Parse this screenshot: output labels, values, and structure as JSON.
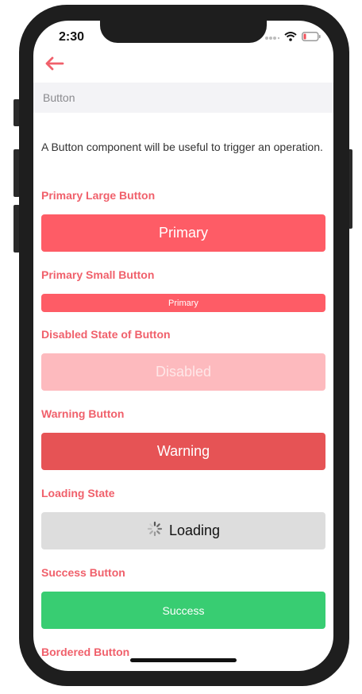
{
  "status_bar": {
    "time": "2:30"
  },
  "header": {
    "back_icon": "arrow-left-icon",
    "section_title": "Button"
  },
  "intro": {
    "text": "A Button component will be useful to trigger an operation."
  },
  "sections": {
    "primary_large": {
      "label": "Primary Large Button",
      "button_text": "Primary"
    },
    "primary_small": {
      "label": "Primary Small Button",
      "button_text": "Primary"
    },
    "disabled": {
      "label": "Disabled State of Button",
      "button_text": "Disabled"
    },
    "warning": {
      "label": "Warning Button",
      "button_text": "Warning"
    },
    "loading": {
      "label": "Loading State",
      "button_text": "Loading"
    },
    "success": {
      "label": "Success Button",
      "button_text": "Success"
    },
    "bordered": {
      "label": "Bordered Button"
    }
  },
  "colors": {
    "accent": "#f0606b",
    "primary": "#fe5c66",
    "disabled": "#fdbabe",
    "warning": "#e65355",
    "loading": "#dddddd",
    "success": "#38cd72"
  }
}
